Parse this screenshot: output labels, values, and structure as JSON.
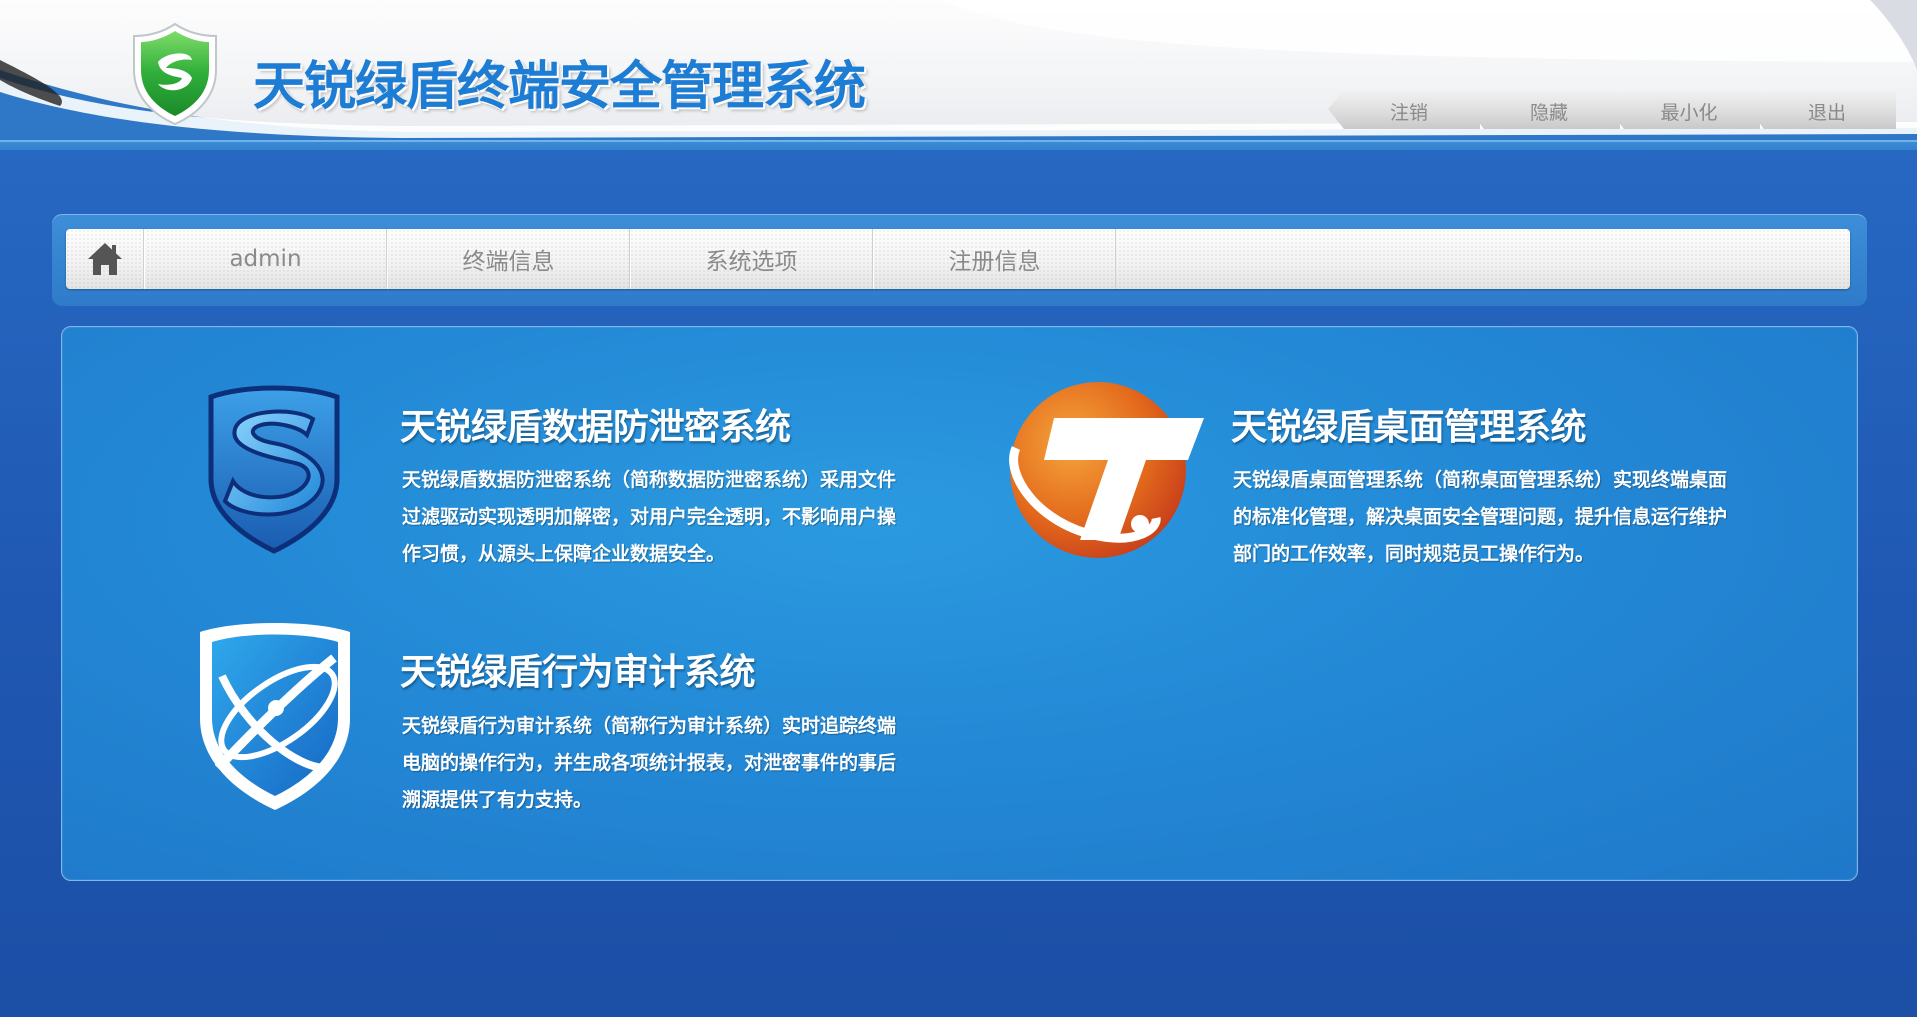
{
  "app": {
    "title": "天锐绿盾终端安全管理系统"
  },
  "window_controls": {
    "logout": "注销",
    "hide": "隐藏",
    "minimize": "最小化",
    "exit": "退出"
  },
  "nav": {
    "items": [
      {
        "label": "admin"
      },
      {
        "label": "终端信息"
      },
      {
        "label": "系统选项"
      },
      {
        "label": "注册信息"
      }
    ]
  },
  "products": [
    {
      "title": "天锐绿盾数据防泄密系统",
      "description": "天锐绿盾数据防泄密系统（简称数据防泄密系统）采用文件过滤驱动实现透明加解密，对用户完全透明，不影响用户操作习惯，从源头上保障企业数据安全。"
    },
    {
      "title": "天锐绿盾桌面管理系统",
      "description": "天锐绿盾桌面管理系统（简称桌面管理系统）实现终端桌面的标准化管理，解决桌面安全管理问题，提升信息运行维护部门的工作效率，同时规范员工操作行为。"
    },
    {
      "title": "天锐绿盾行为审计系统",
      "description": "天锐绿盾行为审计系统（简称行为审计系统）实时追踪终端电脑的操作行为，并生成各项统计报表，对泄密事件的事后溯源提供了有力支持。"
    }
  ],
  "colors": {
    "title_blue": "#1d7cd4",
    "background_blue": "#2463bd",
    "panel_blue": "#2389d6",
    "logo_green": "#2fae3a",
    "orange_icon": "#e36a1c"
  }
}
